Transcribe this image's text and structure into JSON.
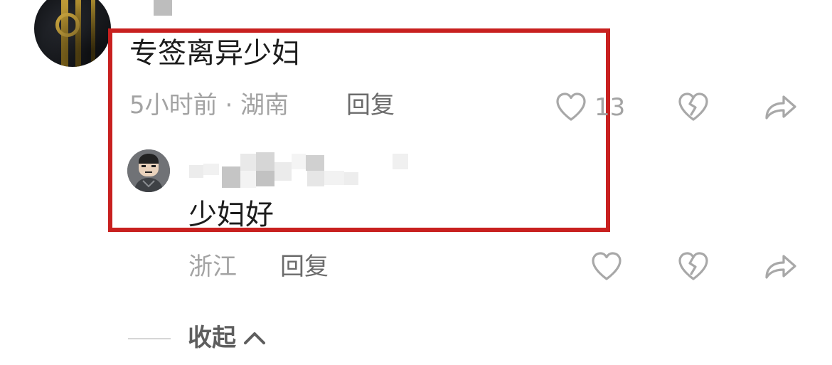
{
  "comment": {
    "text": "专签离异少妇",
    "meta": "5小时前 · 湖南",
    "reply_label": "回复",
    "like_count": "13"
  },
  "reply": {
    "text": "少妇好",
    "location": "浙江",
    "reply_label": "回复"
  },
  "collapse": {
    "label": "收起"
  },
  "colors": {
    "highlight_border": "#c8201f",
    "icon_gray": "#a8a8a8",
    "meta_gray": "#a3a3a3"
  },
  "icons": [
    "heart-icon",
    "broken-heart-icon",
    "share-arrow-icon",
    "chevron-up-icon"
  ]
}
